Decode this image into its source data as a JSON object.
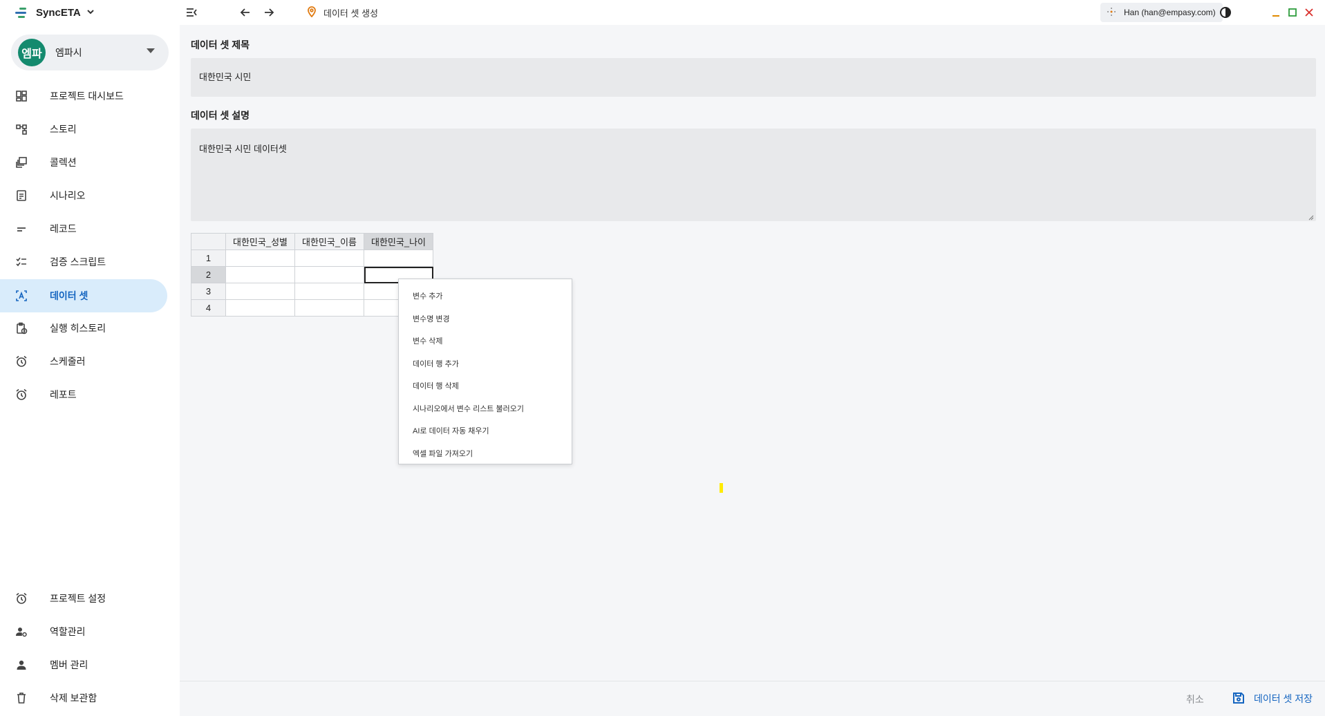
{
  "app": {
    "name": "SyncETA",
    "workspace_avatar": "엠파",
    "workspace_name": "엠파시"
  },
  "nav": {
    "items": [
      {
        "label": "프로젝트 대시보드",
        "icon": "dashboard-icon"
      },
      {
        "label": "스토리",
        "icon": "story-icon"
      },
      {
        "label": "콜렉션",
        "icon": "collection-icon"
      },
      {
        "label": "시나리오",
        "icon": "scenario-icon"
      },
      {
        "label": "레코드",
        "icon": "record-icon"
      },
      {
        "label": "검증 스크립트",
        "icon": "checklist-icon"
      },
      {
        "label": "데이터 셋",
        "icon": "dataset-icon"
      },
      {
        "label": "실행 히스토리",
        "icon": "history-icon"
      },
      {
        "label": "스케줄러",
        "icon": "alarm-icon"
      },
      {
        "label": "레포트",
        "icon": "alarm-icon"
      }
    ],
    "bottom_items": [
      {
        "label": "프로젝트 설정",
        "icon": "alarm-icon"
      },
      {
        "label": "역할관리",
        "icon": "role-icon"
      },
      {
        "label": "멤버 관리",
        "icon": "person-icon"
      },
      {
        "label": "삭제 보관함",
        "icon": "trash-icon"
      }
    ]
  },
  "topbar": {
    "breadcrumb": "데이터 셋 생성",
    "user": "Han (han@empasy.com)"
  },
  "form": {
    "title_label": "데이터 셋 제목",
    "title_value": "대한민국 시민",
    "desc_label": "데이터 셋 설명",
    "desc_value": "대한민국 시민 데이터셋"
  },
  "grid": {
    "columns": [
      "대한민국_성별",
      "대한민국_이름",
      "대한민국_나이"
    ],
    "rows": [
      "1",
      "2",
      "3",
      "4"
    ]
  },
  "context_menu": {
    "items": [
      "변수 추가",
      "변수명 변경",
      "변수 삭제",
      "데이터 행 추가",
      "데이터 행 삭제",
      "시나리오에서 변수 리스트 불러오기",
      "AI로 데이터 자동 채우기",
      "엑셀 파일 가져오기"
    ]
  },
  "footer": {
    "cancel_label": "취소",
    "save_label": "데이터 셋 저장"
  },
  "colors": {
    "accent": "#1565c0",
    "active_nav_bg": "#d9ecfb",
    "avatar_bg": "#148a6e"
  }
}
